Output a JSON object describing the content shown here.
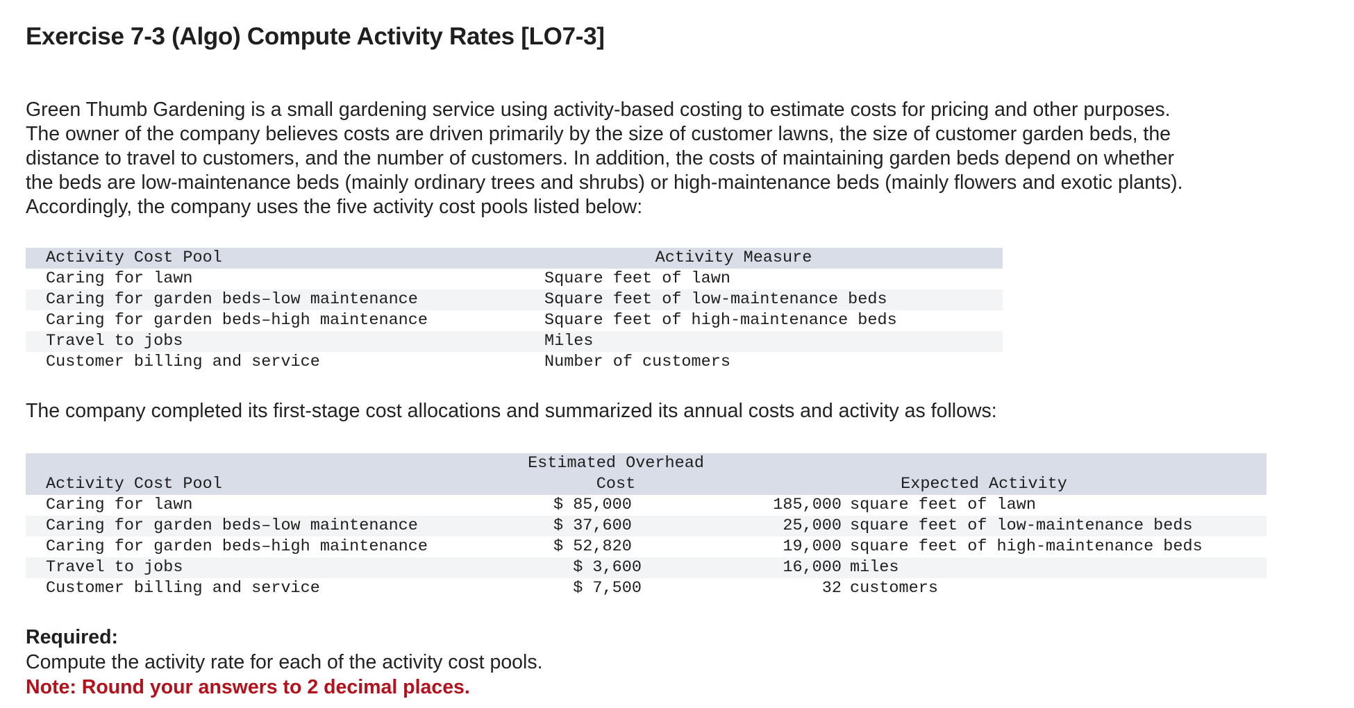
{
  "title": "Exercise 7-3 (Algo) Compute Activity Rates [LO7-3]",
  "intro_lines": [
    "Green Thumb Gardening is a small gardening service using activity-based costing to estimate costs for pricing and other purposes.",
    "The owner of the company believes costs are driven primarily by the size of customer lawns, the size of customer garden beds, the",
    "distance to travel to customers, and the number of customers. In addition, the costs of maintaining garden beds depend on whether",
    "the beds are low-maintenance beds (mainly ordinary trees and shrubs) or high-maintenance beds (mainly flowers and exotic plants).",
    "Accordingly, the company uses the five activity cost pools listed below:"
  ],
  "table1": {
    "headers": [
      "Activity Cost Pool",
      "Activity Measure"
    ],
    "rows": [
      [
        "Caring for lawn",
        "Square feet of lawn"
      ],
      [
        "Caring for garden beds–low maintenance",
        "Square feet of low-maintenance beds"
      ],
      [
        "Caring for garden beds–high maintenance",
        "Square feet of high-maintenance beds"
      ],
      [
        "Travel to jobs",
        "Miles"
      ],
      [
        "Customer billing and service",
        "Number of customers"
      ]
    ]
  },
  "mid_text": "The company completed its first-stage cost allocations and summarized its annual costs and activity as follows:",
  "table2": {
    "header_pool": "Activity Cost Pool",
    "header_cost_line1": "Estimated Overhead",
    "header_cost_line2": "Cost",
    "header_activity": "Expected Activity",
    "rows": [
      {
        "pool": "Caring for lawn",
        "cost": "$ 85,000",
        "qty": "185,000",
        "unit": "square feet of lawn"
      },
      {
        "pool": "Caring for garden beds–low maintenance",
        "cost": "$ 37,600",
        "qty": "25,000",
        "unit": "square feet of low-maintenance beds"
      },
      {
        "pool": "Caring for garden beds–high maintenance",
        "cost": "$ 52,820",
        "qty": "19,000",
        "unit": "square feet of high-maintenance beds"
      },
      {
        "pool": "Travel to jobs",
        "cost": "  $ 3,600",
        "qty": "16,000",
        "unit": "miles"
      },
      {
        "pool": "Customer billing and service",
        "cost": "  $ 7,500",
        "qty": "32",
        "unit": "customers"
      }
    ]
  },
  "required": {
    "label": "Required:",
    "text": "Compute the activity rate for each of the activity cost pools.",
    "note": "Note: Round your answers to 2 decimal places."
  },
  "colors": {
    "header_bg": "#d8dde7",
    "shade_bg": "#f3f4f6",
    "note_red": "#b3111b"
  }
}
